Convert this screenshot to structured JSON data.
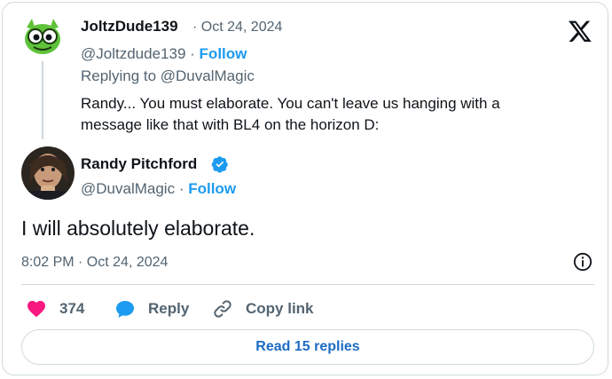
{
  "reply_tweet": {
    "author_name": "JoltzDude139",
    "date": "Oct 24, 2024",
    "handle": "@Joltzdude139",
    "follow_label": "Follow",
    "replying_to": "Replying to @DuvalMagic",
    "text": "Randy... You must elaborate. You can't leave us hanging with a message like that with BL4 on the horizon D:"
  },
  "main_tweet": {
    "author_name": "Randy Pitchford",
    "handle": "@DuvalMagic",
    "follow_label": "Follow",
    "text": "I will absolutely elaborate.",
    "timestamp": "8:02 PM · Oct 24, 2024"
  },
  "actions": {
    "like_count": "374",
    "reply_label": "Reply",
    "copy_label": "Copy link"
  },
  "read_replies_label": "Read 15 replies",
  "separator": "·",
  "icons": [
    "x-logo-icon",
    "verified-badge-icon",
    "info-icon",
    "heart-icon",
    "reply-bubble-icon",
    "link-icon"
  ],
  "colors": {
    "accent": "#1d9bf0",
    "like": "#f91880",
    "secondary_text": "#536471",
    "border": "#cfd9de"
  }
}
